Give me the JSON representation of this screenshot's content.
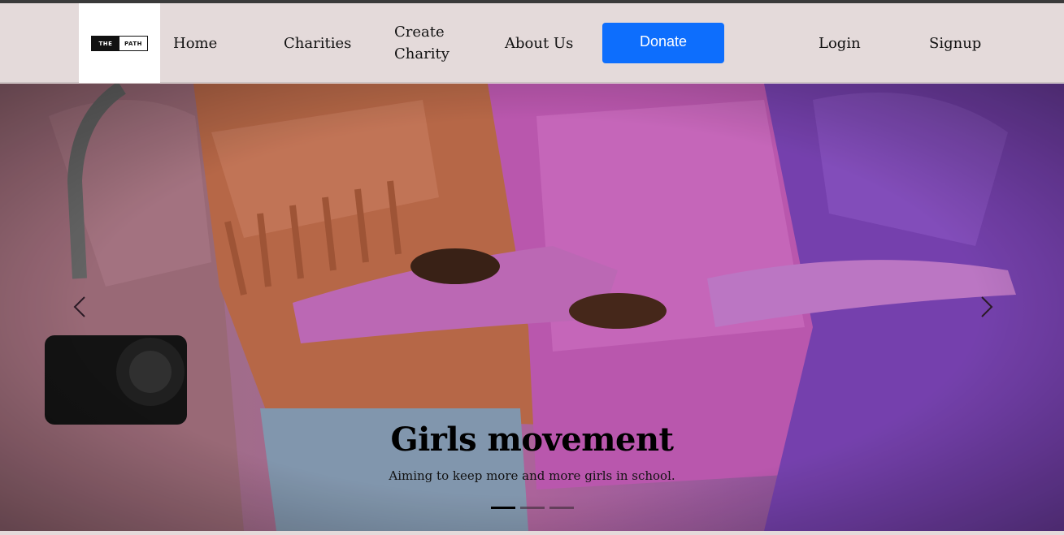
{
  "brand": {
    "logo_left": "THE",
    "logo_right": "PATH"
  },
  "nav": {
    "home": "Home",
    "charities": "Charities",
    "create_charity": "Create Charity",
    "about": "About Us",
    "donate": "Donate",
    "login": "Login",
    "signup": "Signup"
  },
  "colors": {
    "navbar_bg": "#e4dada",
    "donate_bg": "#0d6efd"
  },
  "carousel": {
    "slide_title": "Girls movement",
    "slide_subtitle": "Aiming to keep more and more girls in school.",
    "indicator_count": 3,
    "active_indicator": 1,
    "prev_icon": "chevron-left-icon",
    "next_icon": "chevron-right-icon"
  }
}
